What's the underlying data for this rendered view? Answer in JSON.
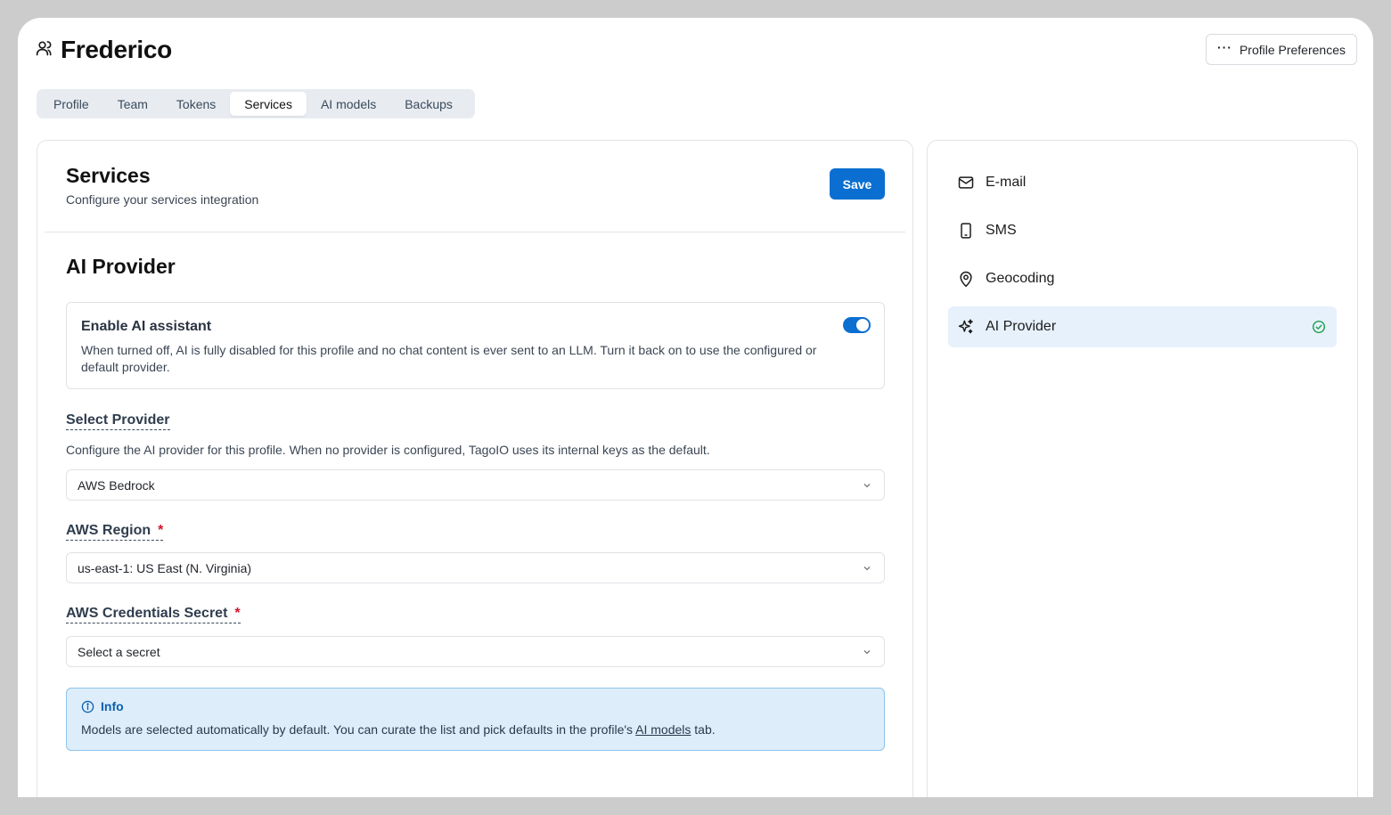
{
  "header": {
    "title": "Frederico",
    "title_icon": "users-icon",
    "preferences_label": "Profile Preferences",
    "preferences_icon": "dots-icon"
  },
  "tabs": [
    {
      "label": "Profile",
      "active": false
    },
    {
      "label": "Team",
      "active": false
    },
    {
      "label": "Tokens",
      "active": false
    },
    {
      "label": "Services",
      "active": true
    },
    {
      "label": "AI models",
      "active": false
    },
    {
      "label": "Backups",
      "active": false
    }
  ],
  "main": {
    "title": "Services",
    "subtitle": "Configure your services integration",
    "save_label": "Save",
    "section_title": "AI Provider",
    "ai_toggle": {
      "label": "Enable AI assistant",
      "description": "When turned off, AI is fully disabled for this profile and no chat content is ever sent to an LLM. Turn it back on to use the configured or default provider.",
      "enabled": true
    },
    "provider": {
      "label": "Select Provider",
      "help": "Configure the AI provider for this profile. When no provider is configured, TagoIO uses its internal keys as the default.",
      "value": "AWS Bedrock"
    },
    "region": {
      "label": "AWS Region",
      "required_mark": "*",
      "value": "us-east-1: US East (N. Virginia)"
    },
    "credentials": {
      "label": "AWS Credentials Secret",
      "required_mark": "*",
      "placeholder": "Select a secret"
    },
    "info": {
      "title": "Info",
      "text_before": "Models are selected automatically by default. You can curate the list and pick defaults in the profile's ",
      "link": "AI models",
      "text_after": " tab."
    }
  },
  "sidebar": {
    "items": [
      {
        "label": "E-mail",
        "icon": "mail-icon",
        "active": false
      },
      {
        "label": "SMS",
        "icon": "phone-icon",
        "active": false
      },
      {
        "label": "Geocoding",
        "icon": "map-pin-icon",
        "active": false
      },
      {
        "label": "AI Provider",
        "icon": "sparkles-icon",
        "active": true,
        "status_icon": "check-circle-icon"
      }
    ]
  },
  "colors": {
    "primary": "#0a6fd1",
    "info_bg": "#ddedf9",
    "active_item_bg": "#e6f1fb",
    "success": "#1e9e4a",
    "required": "#d0142c"
  }
}
